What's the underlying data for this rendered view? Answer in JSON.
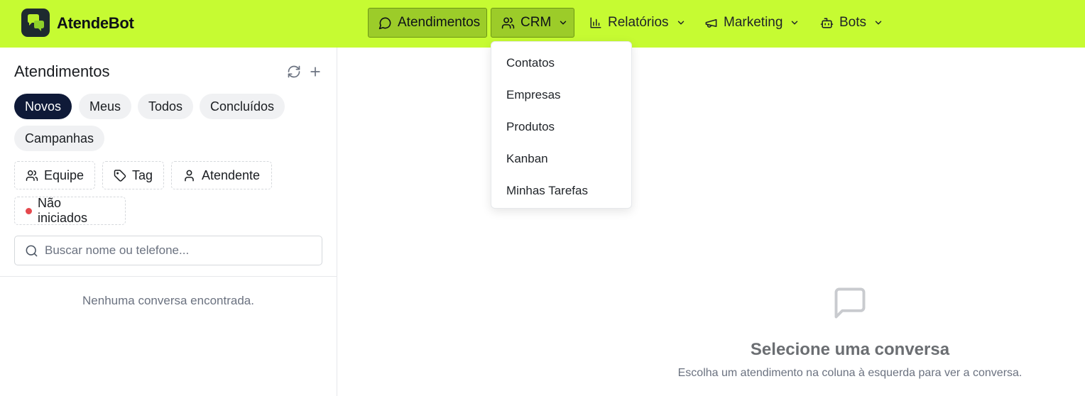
{
  "brand": {
    "name": "AtendeBot"
  },
  "nav": {
    "atendimentos": "Atendimentos",
    "crm": "CRM",
    "relatorios": "Relatórios",
    "marketing": "Marketing",
    "bots": "Bots"
  },
  "crm_menu": {
    "items": [
      "Contatos",
      "Empresas",
      "Produtos",
      "Kanban",
      "Minhas Tarefas"
    ]
  },
  "sidebar": {
    "title": "Atendimentos",
    "tabs": [
      "Novos",
      "Meus",
      "Todos",
      "Concluídos",
      "Campanhas"
    ],
    "selected_tab": "Novos",
    "filters": {
      "equipe": "Equipe",
      "tag": "Tag",
      "atendente": "Atendente",
      "nao_iniciados": "Não iniciados"
    },
    "search": {
      "placeholder": "Buscar nome ou telefone...",
      "value": ""
    },
    "empty_text": "Nenhuma conversa encontrada."
  },
  "main": {
    "empty_title": "Selecione uma conversa",
    "empty_subtitle": "Escolha um atendimento na coluna à esquerda para ver a conversa."
  },
  "colors": {
    "topbar": "#c6fb32",
    "active_nav": "#9ccc29",
    "selected_tab": "#0f1a38",
    "status_dot": "#e5484d"
  },
  "icons": {
    "logo": "chat-bubbles-logo",
    "atendimentos": "message-circle-icon",
    "crm": "users-icon",
    "relatorios": "bar-chart-icon",
    "marketing": "megaphone-icon",
    "bots": "bot-icon",
    "refresh": "refresh-icon",
    "add": "plus-icon",
    "equipe": "users-icon",
    "tag": "tag-icon",
    "atendente": "user-icon",
    "search": "search-icon",
    "empty": "message-square-icon"
  }
}
